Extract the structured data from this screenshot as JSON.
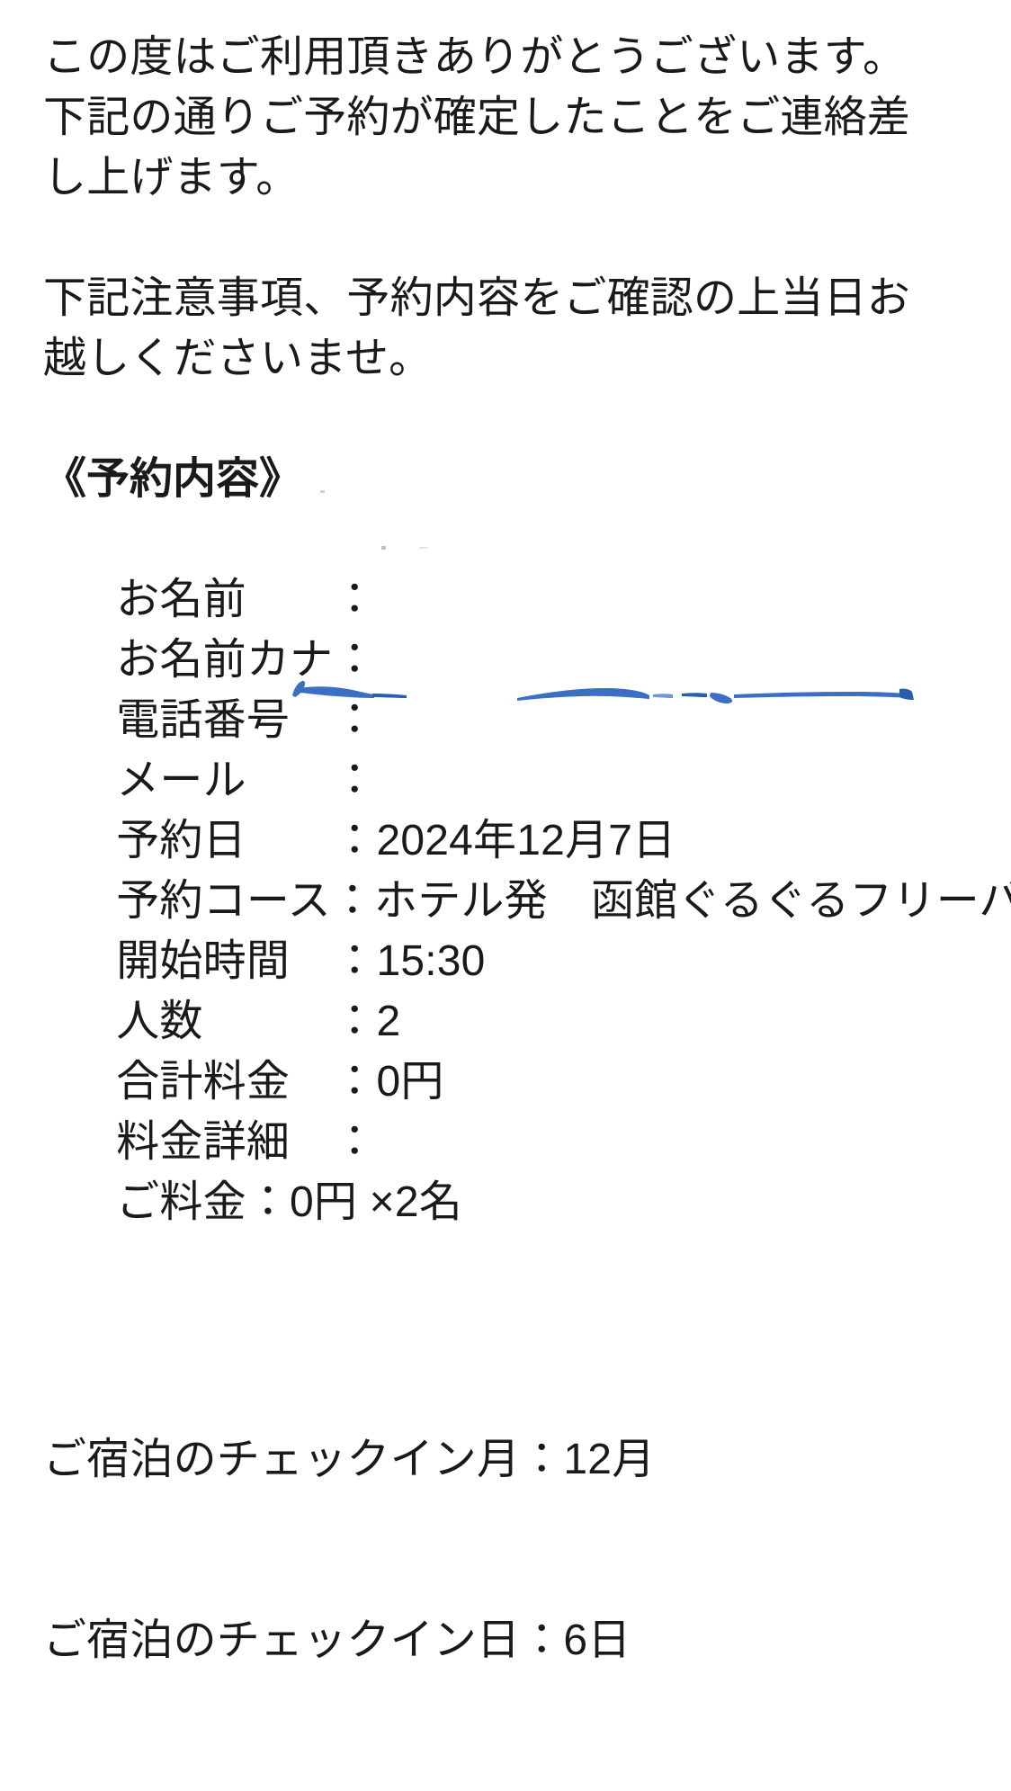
{
  "document": {
    "type": "reservation-confirmation-email",
    "language": "ja",
    "background_color": "#ffffff",
    "text_color": "#1a1a1a",
    "redaction_color": "#3b6fc4"
  },
  "intro": {
    "paragraph_1": "この度はご利用頂きありがとうございます。\n下記の通りご予約が確定したことをご連絡差し上げます。",
    "paragraph_2": "下記注意事項、予約内容をご確認の上当日お越しくださいませ。"
  },
  "reservation": {
    "heading": "《予約内容》",
    "rows": [
      {
        "label": "お名前",
        "label_padded": "お名前　　",
        "colon": "：",
        "value": "",
        "redacted": true
      },
      {
        "label": "お名前カナ",
        "label_padded": "お名前カナ",
        "colon": "：",
        "value": "",
        "redacted": true
      },
      {
        "label": "電話番号",
        "label_padded": "電話番号　",
        "colon": "：",
        "value": "",
        "redacted": true
      },
      {
        "label": "メール",
        "label_padded": "メール　　",
        "colon": "：",
        "value": "",
        "redacted": true
      },
      {
        "label": "予約日",
        "label_padded": "予約日　　",
        "colon": "：",
        "value": "2024年12月7日",
        "redacted": false
      },
      {
        "label": "予約コース",
        "label_padded": "予約コース",
        "colon": "：",
        "value": "ホテル発　函館ぐるぐるフリーバス",
        "redacted": false
      },
      {
        "label": "開始時間",
        "label_padded": "開始時間　",
        "colon": "：",
        "value": "15:30",
        "redacted": false
      },
      {
        "label": "人数",
        "label_padded": "人数　　　",
        "colon": "：",
        "value": "2",
        "redacted": false
      },
      {
        "label": "合計料金",
        "label_padded": "合計料金　",
        "colon": "：",
        "value": "0円",
        "redacted": false
      },
      {
        "label": "料金詳細",
        "label_padded": "料金詳細　",
        "colon": "：",
        "value": "",
        "redacted": false
      }
    ],
    "fee_detail_line": "ご料金：0円 ×2名"
  },
  "stay": {
    "checkin_month_line": "ご宿泊のチェックイン月：12月",
    "checkin_day_line": "ご宿泊のチェックイン日：6日"
  }
}
